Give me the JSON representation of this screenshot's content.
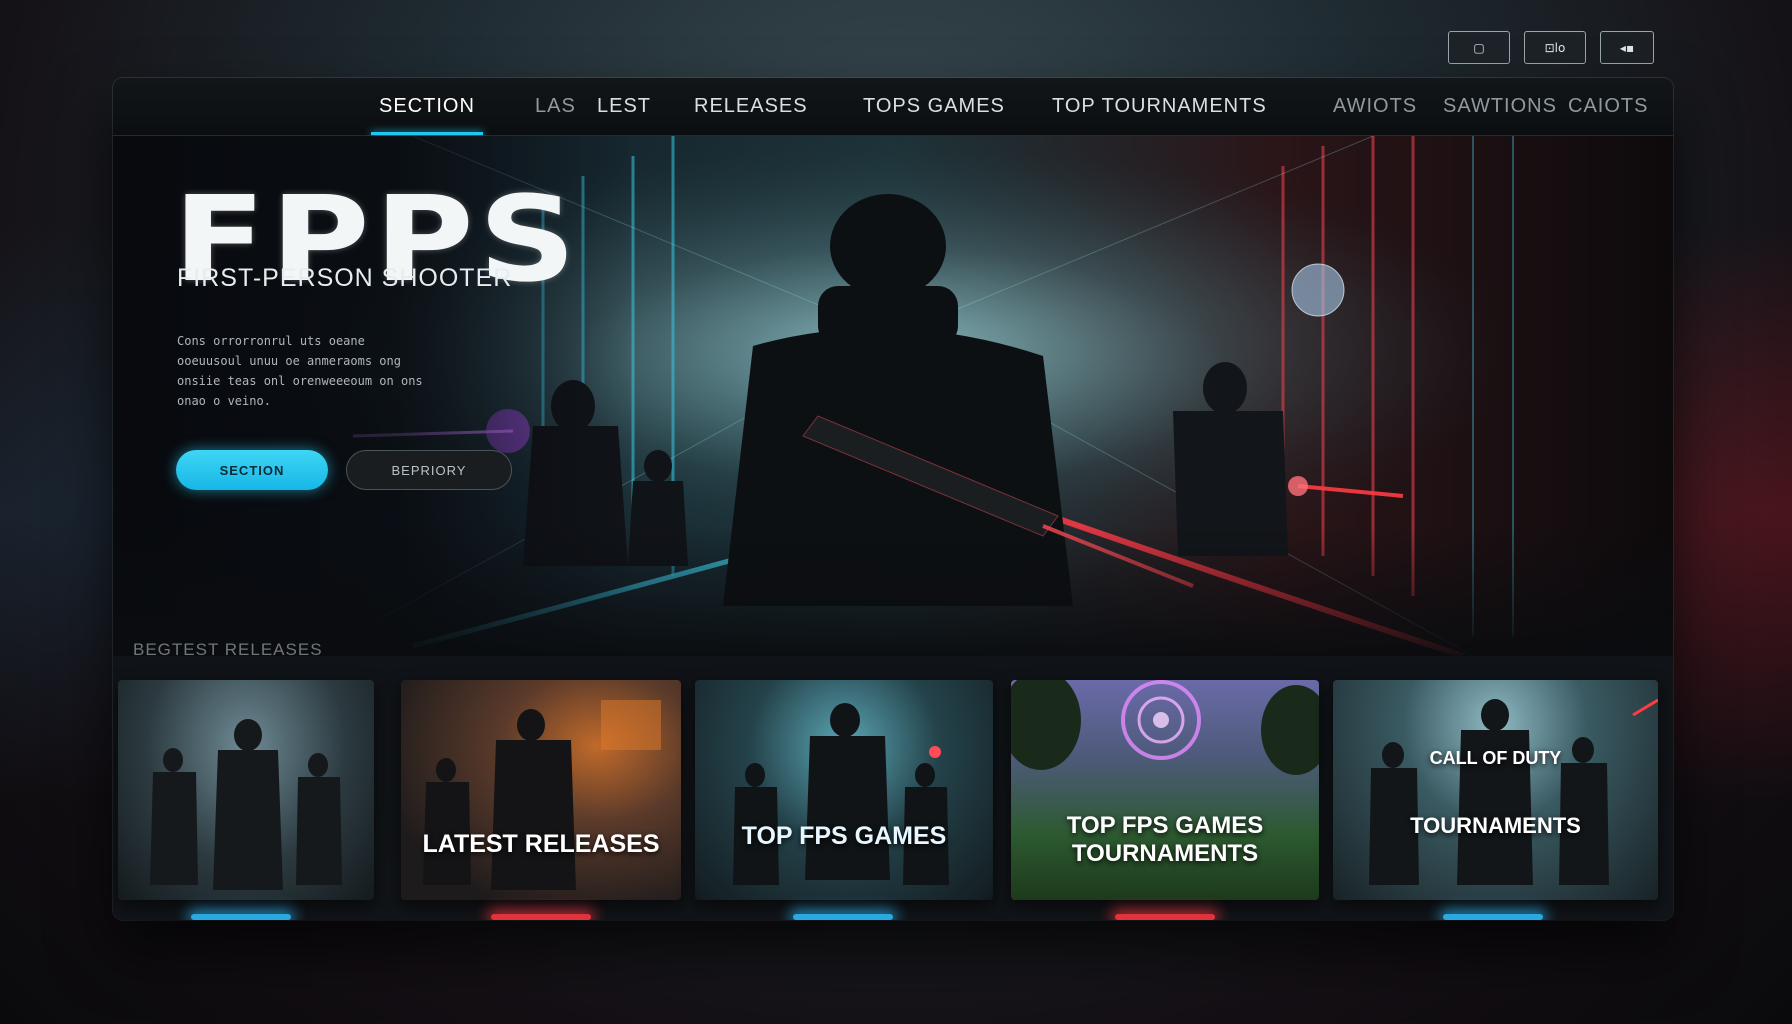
{
  "window_controls": [
    {
      "label": "▢"
    },
    {
      "label": "⊡lo"
    },
    {
      "label": "◂▪"
    }
  ],
  "nav": {
    "items": [
      {
        "label": "SECTION"
      },
      {
        "label": "LAS"
      },
      {
        "label": "LEST"
      },
      {
        "label": "RELEASES"
      },
      {
        "label": "TOPS GAMES"
      },
      {
        "label": "TOP TOURNAMENTS"
      },
      {
        "label": "AWIOTS"
      },
      {
        "label": "SAWTIONS"
      },
      {
        "label": "CAIOTS"
      }
    ]
  },
  "hero": {
    "title": "FPPS",
    "subtitle": "FIRST-PERSON SHOOTER",
    "description": "Cons orrorronrul uts oeane ooeuusoul unuu oe anmeraoms ong onsiie teas onl orenweeeoum on ons onao o veino.",
    "primary_button": "SECTION",
    "secondary_button": "BEPRIORY"
  },
  "section_heading": "BEGTEST RELEASES",
  "cards": [
    {
      "label": "",
      "accent": "#2aa8e0"
    },
    {
      "label": "LATEST RELEASES",
      "accent": "#e0343c"
    },
    {
      "label": "TOP FPS GAMES",
      "accent": "#2aa8e0"
    },
    {
      "label": "TOP FPS GAMES TOURNAMENTS",
      "accent": "#e0343c"
    },
    {
      "label": "TOURNAMENTS",
      "overlay": "CALL OF DUTY",
      "accent": "#2aa8e0"
    }
  ],
  "colors": {
    "accent_cyan": "#1fc8ef",
    "accent_red": "#e0343c"
  }
}
